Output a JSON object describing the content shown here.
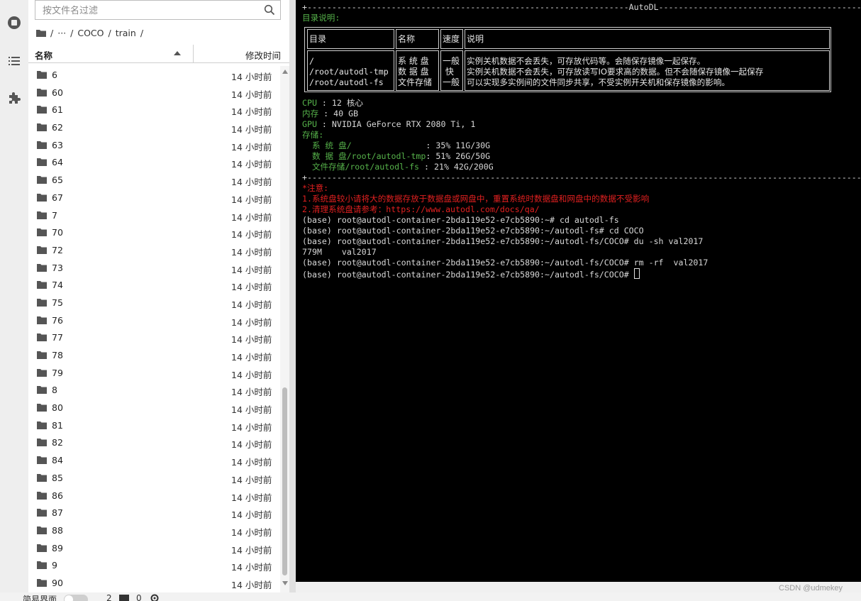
{
  "file_browser": {
    "search_placeholder": "按文件名过滤",
    "breadcrumb": {
      "root": "/",
      "ellipsis": "···",
      "sep": "/",
      "parts": [
        "COCO",
        "train"
      ]
    },
    "header": {
      "name": "名称",
      "modified": "修改时间"
    },
    "rows": [
      {
        "name": "6",
        "time": "14 小时前"
      },
      {
        "name": "60",
        "time": "14 小时前"
      },
      {
        "name": "61",
        "time": "14 小时前"
      },
      {
        "name": "62",
        "time": "14 小时前"
      },
      {
        "name": "63",
        "time": "14 小时前"
      },
      {
        "name": "64",
        "time": "14 小时前"
      },
      {
        "name": "65",
        "time": "14 小时前"
      },
      {
        "name": "67",
        "time": "14 小时前"
      },
      {
        "name": "7",
        "time": "14 小时前"
      },
      {
        "name": "70",
        "time": "14 小时前"
      },
      {
        "name": "72",
        "time": "14 小时前"
      },
      {
        "name": "73",
        "time": "14 小时前"
      },
      {
        "name": "74",
        "time": "14 小时前"
      },
      {
        "name": "75",
        "time": "14 小时前"
      },
      {
        "name": "76",
        "time": "14 小时前"
      },
      {
        "name": "77",
        "time": "14 小时前"
      },
      {
        "name": "78",
        "time": "14 小时前"
      },
      {
        "name": "79",
        "time": "14 小时前"
      },
      {
        "name": "8",
        "time": "14 小时前"
      },
      {
        "name": "80",
        "time": "14 小时前"
      },
      {
        "name": "81",
        "time": "14 小时前"
      },
      {
        "name": "82",
        "time": "14 小时前"
      },
      {
        "name": "84",
        "time": "14 小时前"
      },
      {
        "name": "85",
        "time": "14 小时前"
      },
      {
        "name": "86",
        "time": "14 小时前"
      },
      {
        "name": "87",
        "time": "14 小时前"
      },
      {
        "name": "88",
        "time": "14 小时前"
      },
      {
        "name": "89",
        "time": "14 小时前"
      },
      {
        "name": "9",
        "time": "14 小时前"
      },
      {
        "name": "90",
        "time": "14 小时前"
      }
    ]
  },
  "terminal": {
    "banner": "+-----------------------------------------------------------------AutoDL-----------------------------------------------------------------",
    "dir_heading": "目录说明:",
    "table": {
      "headers": [
        "目录",
        "名称",
        "速度",
        "说明"
      ],
      "dirs": "/\n/root/autodl-tmp\n/root/autodl-fs",
      "names": "系 统 盘\n数 据 盘\n文件存储",
      "speeds": "一般\n 快\n一般",
      "descs": "实例关机数据不会丢失，可存放代码等。会随保存镜像一起保存。\n实例关机数据不会丢失，可存放读写IO要求高的数据。但不会随保存镜像一起保存\n可以实现多实例间的文件同步共享，不受实例开关机和保存镜像的影响。"
    },
    "cpu_label": "CPU",
    "cpu_value": " : 12 核心",
    "mem_label": "内存",
    "mem_value": " : 40 GB",
    "gpu_label": "GPU",
    "gpu_value": " : NVIDIA GeForce RTX 2080 Ti, 1",
    "storage_label": "存储:",
    "disks": [
      {
        "label": "  系 统 盘/               ",
        "value": ": 35% 11G/30G"
      },
      {
        "label": "  数 据 盘/root/autodl-tmp",
        "value": ": 51% 26G/50G"
      },
      {
        "label": "  文件存储/root/autodl-fs ",
        "value": ": 21% 42G/200G"
      }
    ],
    "separator": "+---------------------------------------------------------------------------------------------------------------------------------------",
    "notice_title": "*注意:",
    "notice_1": "1.系统盘较小请将大的数据存放于数据盘或网盘中，重置系统时数据盘和网盘中的数据不受影响",
    "notice_2": "2.清理系统盘请参考：https://www.autodl.com/docs/qa/",
    "lines": [
      "(base) root@autodl-container-2bda119e52-e7cb5890:~# cd autodl-fs",
      "(base) root@autodl-container-2bda119e52-e7cb5890:~/autodl-fs# cd COCO",
      "(base) root@autodl-container-2bda119e52-e7cb5890:~/autodl-fs/COCO# du -sh val2017",
      "779M    val2017",
      "(base) root@autodl-container-2bda119e52-e7cb5890:~/autodl-fs/COCO# rm -rf  val2017"
    ],
    "prompt_last": "(base) root@autodl-container-2bda119e52-e7cb5890:~/autodl-fs/COCO# "
  },
  "status_bar": {
    "mode_label": "简易界面",
    "count_1": "2",
    "count_2": "0"
  },
  "watermark": "CSDN @udmekey"
}
